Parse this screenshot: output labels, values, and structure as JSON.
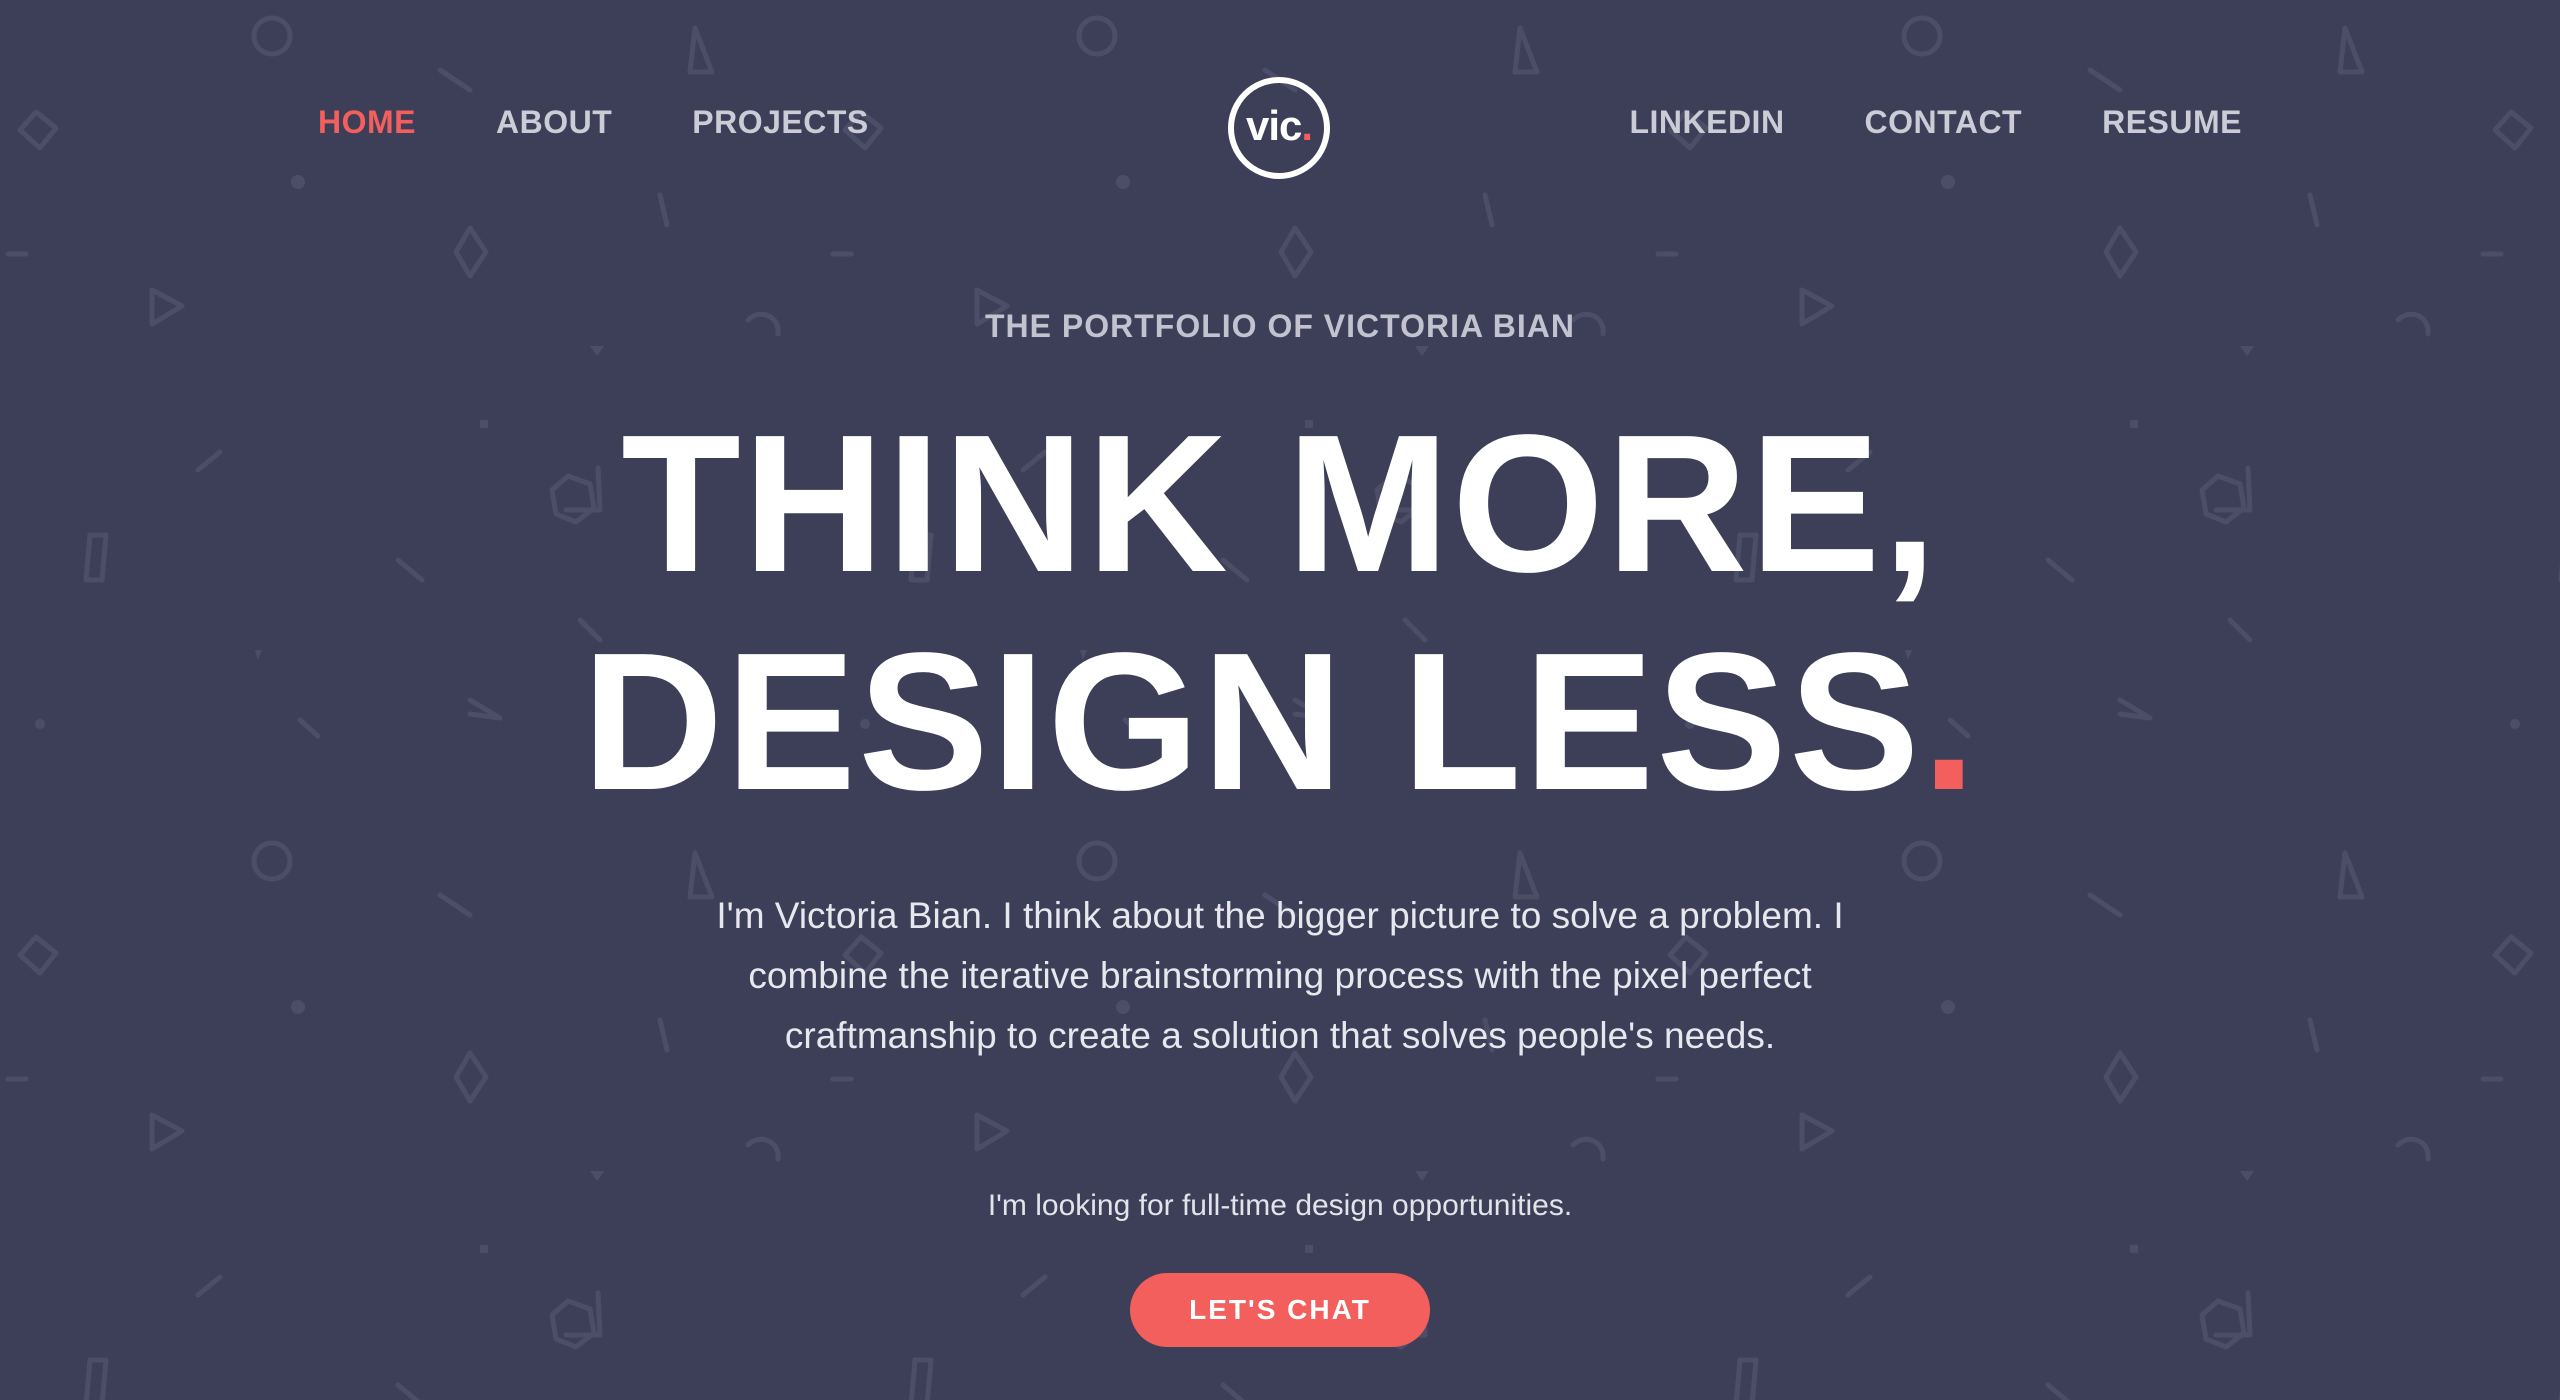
{
  "nav": {
    "left": [
      {
        "label": "HOME",
        "active": true
      },
      {
        "label": "ABOUT",
        "active": false
      },
      {
        "label": "PROJECTS",
        "active": false
      }
    ],
    "right": [
      {
        "label": "LINKEDIN"
      },
      {
        "label": "CONTACT"
      },
      {
        "label": "RESUME"
      }
    ]
  },
  "logo": {
    "text": "vic",
    "dot": "."
  },
  "hero": {
    "eyebrow": "THE PORTFOLIO OF VICTORIA BIAN",
    "headline_line1": "THINK MORE,",
    "headline_line2": "DESIGN LESS",
    "headline_dot": ".",
    "intro": "I'm Victoria Bian. I think about the bigger picture to solve a problem. I combine the iterative brainstorming process with the pixel perfect craftmanship to create a solution that solves people's needs.",
    "seeking": "I'm looking for full-time design opportunities.",
    "cta_label": "LET'S CHAT"
  },
  "colors": {
    "background": "#3d3e57",
    "accent": "#f25f5c",
    "nav_text": "#cbccd6",
    "pattern_stroke": "#4c4d66"
  },
  "icons": [
    "background-geometric-pattern",
    "logo-circle"
  ]
}
